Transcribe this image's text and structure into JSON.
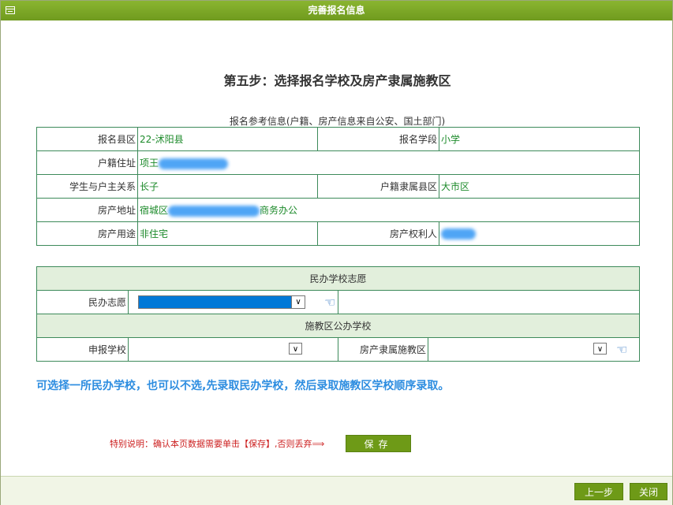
{
  "window": {
    "title": "完善报名信息"
  },
  "step_title": "第五步：选择报名学校及房产隶属施教区",
  "ref_caption": "报名参考信息(户籍、房产信息来自公安、国土部门)",
  "info": {
    "county_label": "报名县区",
    "county_value": "22-沭阳县",
    "stage_label": "报名学段",
    "stage_value": "小学",
    "address_label": "户籍住址",
    "address_value": "项王",
    "relation_label": "学生与户主关系",
    "relation_value": "长子",
    "hukou_area_label": "户籍隶属县区",
    "hukou_area_value": "大市区",
    "property_addr_label": "房产地址",
    "property_addr_prefix": "宿城区",
    "property_addr_suffix": "商务办公",
    "usage_label": "房产用途",
    "usage_value": "非住宅",
    "owner_label": "房产权利人"
  },
  "wish": {
    "private_header": "民办学校志愿",
    "private_label": "民办志愿",
    "public_header": "施教区公办学校",
    "apply_school_label": "申报学校",
    "property_district_label": "房产隶属施教区"
  },
  "note": "可选择一所民办学校，也可以不选,先录取民办学校，然后录取施教区学校顺序录取。",
  "special_note": "特别说明：确认本页数据需要单击【保存】,否则丢弃⟹",
  "buttons": {
    "save": "保存",
    "prev": "上一步",
    "close": "关闭"
  },
  "icons": {
    "select_arrow": "✓",
    "hand": "☜"
  }
}
